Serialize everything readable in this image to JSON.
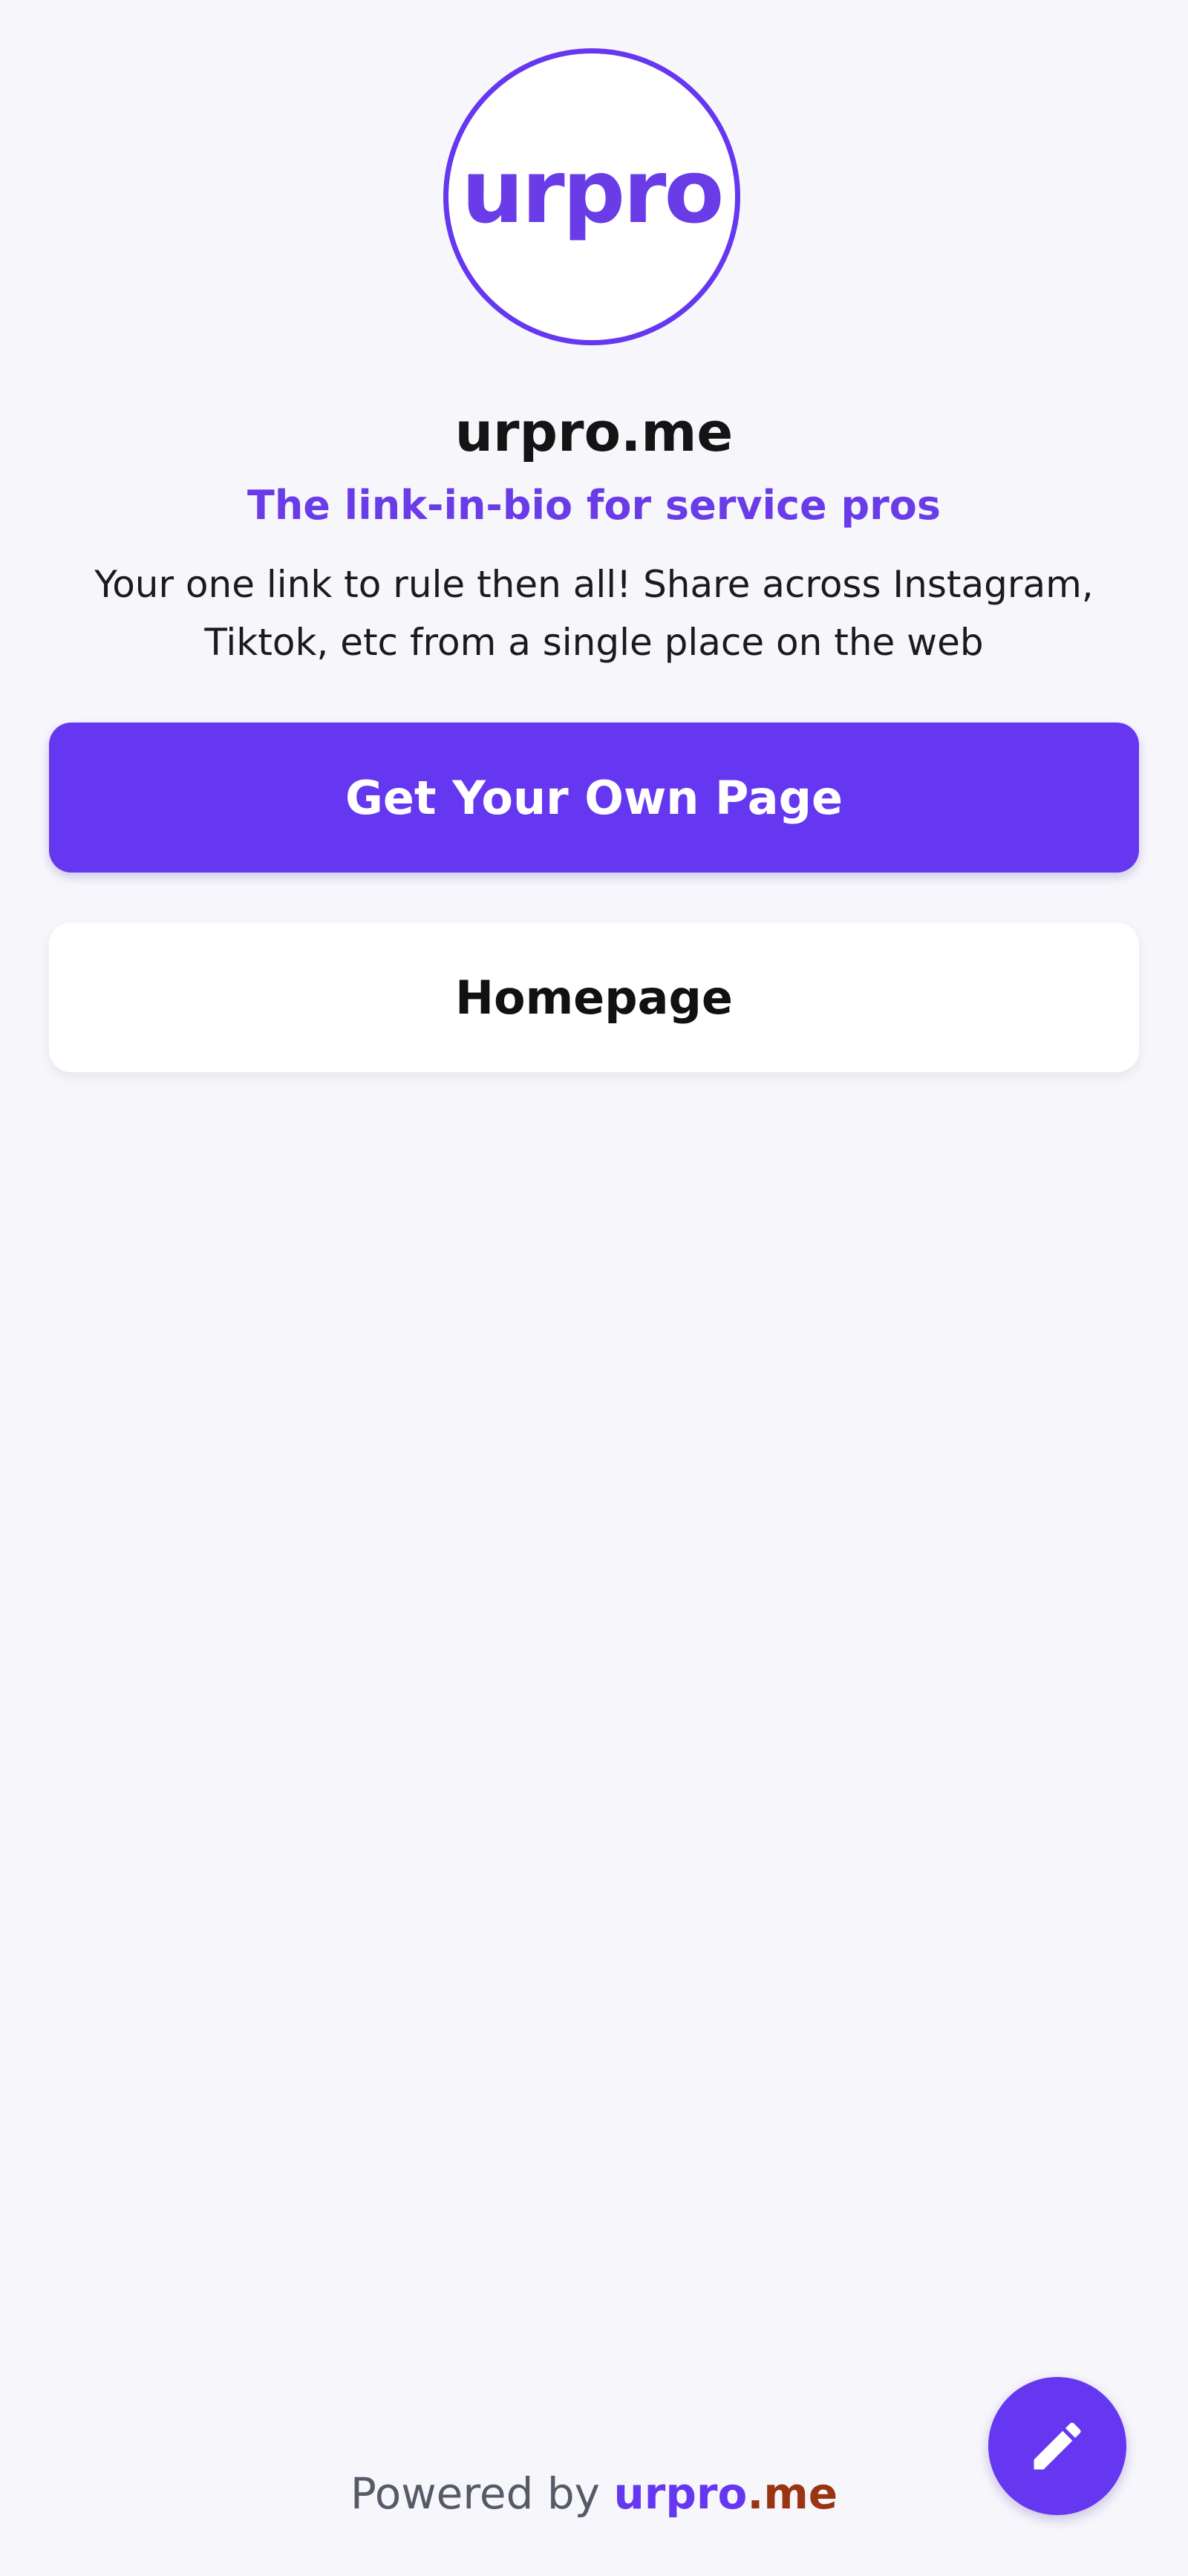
{
  "profile": {
    "avatar_text": "urpro",
    "title": "urpro.me",
    "tagline": "The link-in-bio for service pros",
    "description": "Your one link to rule then all! Share across Instagram, Tiktok, etc from a single place on the web"
  },
  "links": {
    "primary_label": "Get Your Own Page",
    "secondary_label": "Homepage"
  },
  "fab": {
    "icon": "pencil-icon"
  },
  "footer": {
    "prefix": "Powered by",
    "brand_main": "urpro",
    "brand_suffix": ".me"
  },
  "colors": {
    "accent": "#6637f0",
    "background": "#f7f7fb",
    "brand_suffix": "#9a3412"
  }
}
